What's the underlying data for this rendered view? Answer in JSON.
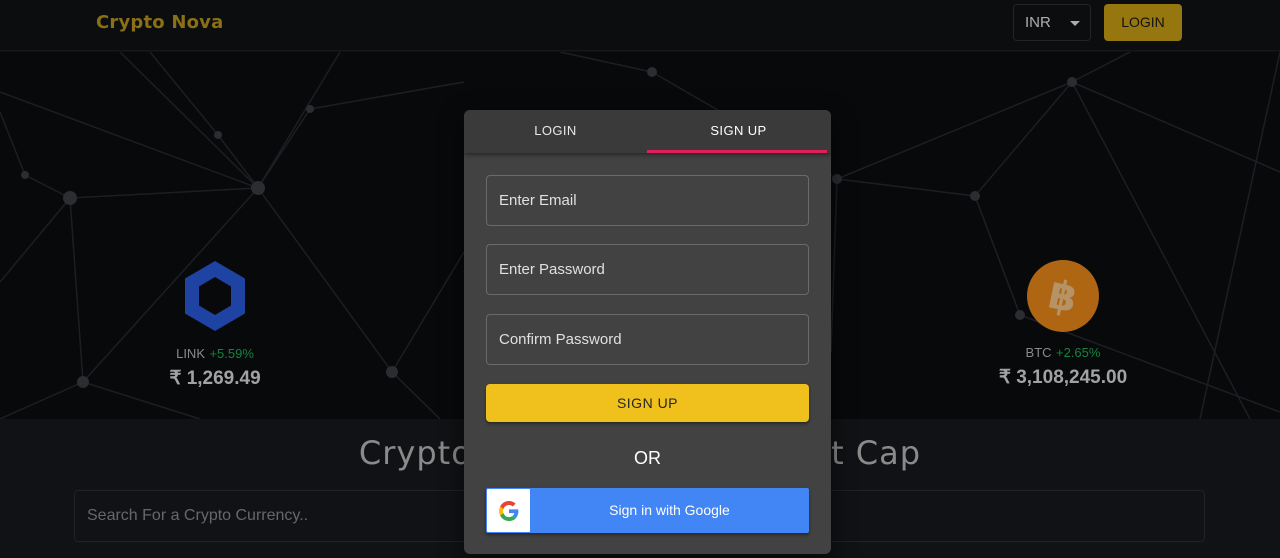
{
  "header": {
    "brand": "Crypto Nova",
    "currency_selected": "INR",
    "login_label": "LOGIN"
  },
  "hero": {
    "coins": [
      {
        "symbol": "LINK",
        "change": "+5.59%",
        "price": "₹ 1,269.49",
        "icon": "chainlink-icon"
      },
      {
        "symbol": "BTC",
        "change": "+2.65%",
        "price": "₹ 3,108,245.00",
        "icon": "bitcoin-icon"
      }
    ]
  },
  "table": {
    "title_left": "Cryptoc",
    "title_right": "et Cap",
    "search_placeholder": "Search For a Crypto Currency.."
  },
  "modal": {
    "tabs": [
      {
        "label": "LOGIN",
        "active": false
      },
      {
        "label": "SIGN UP",
        "active": true
      }
    ],
    "fields": {
      "email_placeholder": "Enter Email",
      "password_placeholder": "Enter Password",
      "confirm_placeholder": "Confirm Password"
    },
    "signup_label": "SIGN UP",
    "or_label": "OR",
    "google_label": "Sign in with Google"
  },
  "colors": {
    "brand": "#b8941c",
    "accent_yellow": "#f0c01c",
    "tab_indicator": "#e11d5a",
    "positive": "#1fae52",
    "google_blue": "#4285f4"
  }
}
